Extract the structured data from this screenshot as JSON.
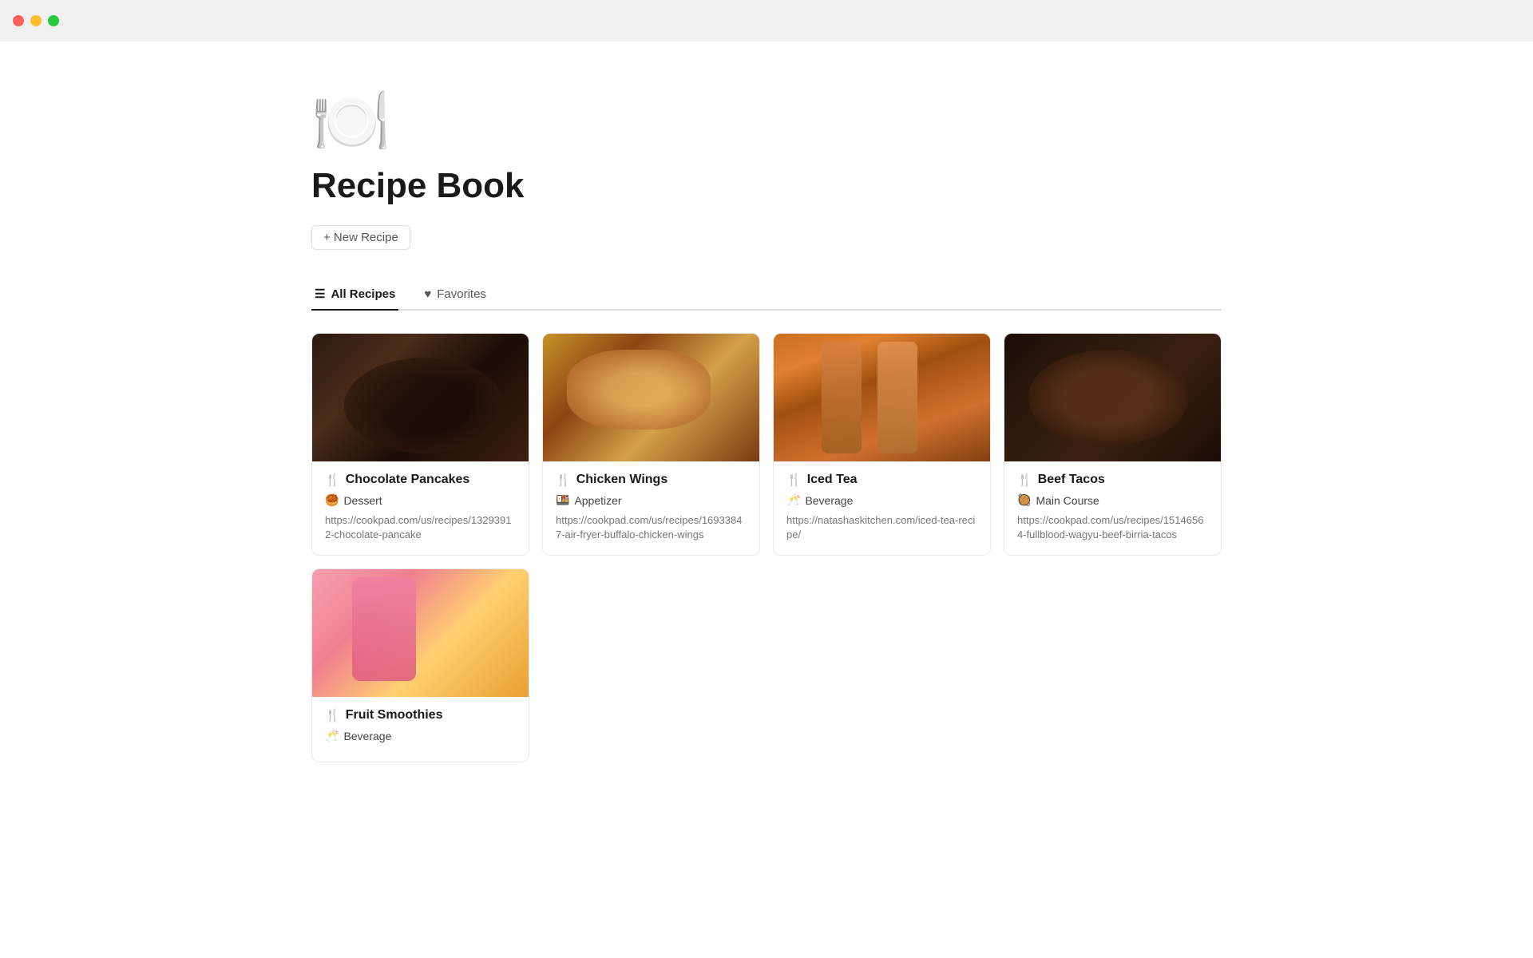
{
  "titlebar": {
    "red_label": "",
    "yellow_label": "",
    "green_label": ""
  },
  "page": {
    "icon": "🍽️",
    "title": "Recipe Book",
    "new_recipe_label": "+ New Recipe"
  },
  "tabs": [
    {
      "id": "all-recipes",
      "label": "All Recipes",
      "icon": "☰",
      "active": true
    },
    {
      "id": "favorites",
      "label": "Favorites",
      "icon": "♥",
      "active": false
    }
  ],
  "recipes": [
    {
      "id": "chocolate-pancakes",
      "name": "Chocolate Pancakes",
      "icon": "🍴",
      "category_icon": "🥮",
      "category": "Dessert",
      "url": "https://cookpad.com/us/recipes/13293912-chocolate-pancake",
      "image_class": "img-chocolate"
    },
    {
      "id": "chicken-wings",
      "name": "Chicken Wings",
      "icon": "🍴",
      "category_icon": "🍱",
      "category": "Appetizer",
      "url": "https://cookpad.com/us/recipes/16933847-air-fryer-buffalo-chicken-wings",
      "image_class": "img-chicken"
    },
    {
      "id": "iced-tea",
      "name": "Iced Tea",
      "icon": "🍴",
      "category_icon": "🥂",
      "category": "Beverage",
      "url": "https://natashaskitchen.com/iced-tea-recipe/",
      "image_class": "img-icedtea"
    },
    {
      "id": "beef-tacos",
      "name": "Beef Tacos",
      "icon": "🍴",
      "category_icon": "🥘",
      "category": "Main Course",
      "url": "https://cookpad.com/us/recipes/15146564-fullblood-wagyu-beef-birria-tacos",
      "image_class": "img-beeftacos"
    },
    {
      "id": "fruit-smoothies",
      "name": "Fruit Smoothies",
      "icon": "🍴",
      "category_icon": "🥂",
      "category": "Beverage",
      "url": "",
      "image_class": "img-smoothies"
    }
  ]
}
